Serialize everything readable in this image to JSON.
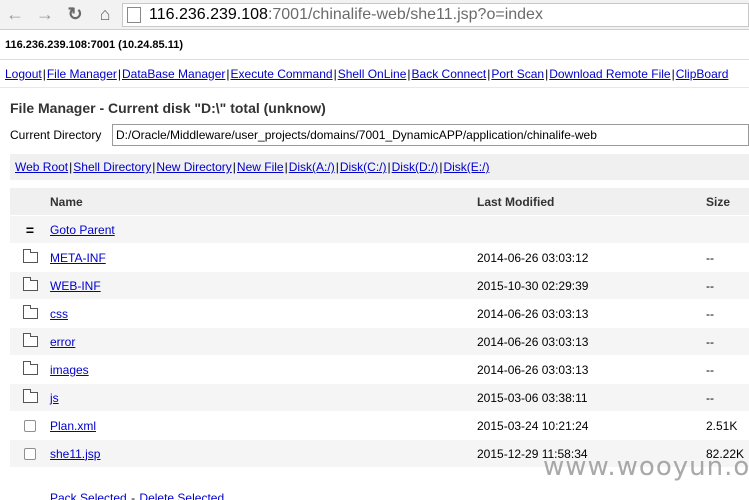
{
  "browser": {
    "url_host": "116.236.239.108",
    "url_rest": ":7001/chinalife-web/she11.jsp?o=index"
  },
  "host_line": "116.236.239.108:7001 (10.24.85.11)",
  "menu": [
    "Logout",
    "File Manager",
    "DataBase Manager",
    "Execute Command",
    "Shell OnLine",
    "Back Connect",
    "Port Scan",
    "Download Remote File",
    "ClipBoard"
  ],
  "file_manager": {
    "title": "File Manager - Current disk \"D:\\\" total (unknow)",
    "current_dir_label": "Current Directory",
    "current_dir_value": "D:/Oracle/Middleware/user_projects/domains/7001_DynamicAPP/application/chinalife-web"
  },
  "subnav": [
    "Web Root",
    "Shell Directory",
    "New Directory",
    "New File",
    "Disk(A:/)",
    "Disk(C:/)",
    "Disk(D:/)",
    "Disk(E:/)"
  ],
  "table": {
    "headers": {
      "name": "Name",
      "modified": "Last Modified",
      "size": "Size"
    },
    "parent": {
      "glyph": "=",
      "label": "Goto Parent"
    },
    "rows": [
      {
        "type": "folder",
        "name": "META-INF",
        "modified": "2014-06-26 03:03:12",
        "size": "--"
      },
      {
        "type": "folder",
        "name": "WEB-INF",
        "modified": "2015-10-30 02:29:39",
        "size": "--"
      },
      {
        "type": "folder",
        "name": "css",
        "modified": "2014-06-26 03:03:13",
        "size": "--"
      },
      {
        "type": "folder",
        "name": "error",
        "modified": "2014-06-26 03:03:13",
        "size": "--"
      },
      {
        "type": "folder",
        "name": "images",
        "modified": "2014-06-26 03:03:13",
        "size": "--"
      },
      {
        "type": "folder",
        "name": "js",
        "modified": "2015-03-06 03:38:11",
        "size": "--"
      },
      {
        "type": "file",
        "name": "Plan.xml",
        "modified": "2015-03-24 10:21:24",
        "size": "2.51K"
      },
      {
        "type": "file",
        "name": "she11.jsp",
        "modified": "2015-12-29 11:58:34",
        "size": "82.22K"
      }
    ]
  },
  "actions": [
    "Pack Selected",
    "Delete Selected"
  ],
  "watermark": "www.wooyun.org"
}
